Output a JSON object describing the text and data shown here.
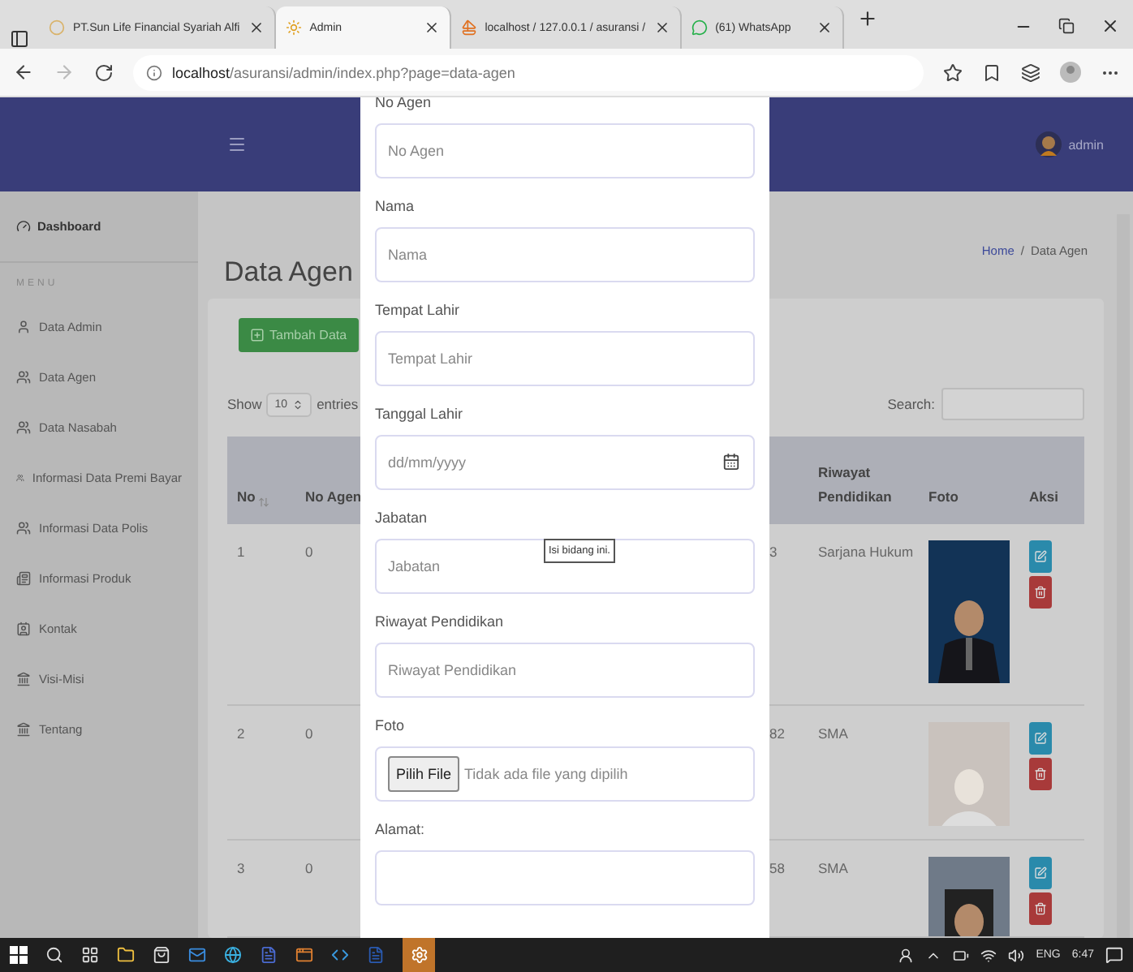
{
  "browser": {
    "tabs": [
      {
        "title": "PT.Sun Life Financial Syariah Alfi",
        "kind": "page",
        "selected": false
      },
      {
        "title": "Admin",
        "kind": "admin",
        "selected": true
      },
      {
        "title": "localhost / 127.0.0.1 / asuransi /",
        "kind": "db",
        "selected": false
      },
      {
        "title": "(61) WhatsApp",
        "kind": "chat",
        "selected": false
      }
    ],
    "url": "**localhost**/asuransi/admin/index.php?page=data-agen"
  },
  "header": {
    "user": "admin"
  },
  "sidebar": {
    "dashboard": "Dashboard",
    "section": "MENU",
    "items": [
      {
        "label": "Data Admin",
        "kind": "user"
      },
      {
        "label": "Data Agen",
        "kind": "group"
      },
      {
        "label": "Data Nasabah",
        "kind": "group"
      },
      {
        "label": "Informasi Data Premi Bayar",
        "kind": "group"
      },
      {
        "label": "Informasi Data Polis",
        "kind": "group"
      },
      {
        "label": "Informasi Produk",
        "kind": "news"
      },
      {
        "label": "Kontak",
        "kind": "contact"
      },
      {
        "label": "Visi-Misi",
        "kind": "building"
      },
      {
        "label": "Tentang",
        "kind": "building"
      }
    ]
  },
  "page": {
    "title": "Data Agen",
    "breadcrumb": {
      "home": "Home",
      "separator": "/",
      "current": "Data Agen"
    },
    "add_button": "Tambah Data",
    "show": {
      "prefix": "Show",
      "value": "10",
      "suffix": "entries"
    },
    "search_label": "Search:",
    "columns": {
      "no": "No",
      "no_agen": "No Agen",
      "riwayat": "Riwayat Pendidikan",
      "foto": "Foto",
      "aksi": "Aksi"
    },
    "rows": [
      {
        "no": "1",
        "no_agen": "0",
        "column_3": "3",
        "riwayat": "Sarjana Hukum"
      },
      {
        "no": "2",
        "no_agen": "0",
        "column_3": "82",
        "riwayat": "SMA"
      },
      {
        "no": "3",
        "no_agen": "0",
        "column_3": "58",
        "riwayat": "SMA"
      }
    ]
  },
  "modal": {
    "fields": [
      {
        "label": "No Agen",
        "kind": "text",
        "placeholder": "No Agen"
      },
      {
        "label": "Nama",
        "kind": "text",
        "placeholder": "Nama"
      },
      {
        "label": "Tempat Lahir",
        "kind": "text",
        "placeholder": "Tempat Lahir"
      },
      {
        "label": "Tanggal Lahir",
        "kind": "date",
        "placeholder": "dd/mm/yyyy"
      },
      {
        "label": "Jabatan",
        "kind": "text",
        "placeholder": "Jabatan"
      },
      {
        "label": "Riwayat Pendidikan",
        "kind": "text",
        "placeholder": "Riwayat Pendidikan"
      },
      {
        "label": "Foto",
        "kind": "file",
        "button": "Pilih File",
        "status": "Tidak ada file yang dipilih"
      },
      {
        "label": "Alamat:",
        "kind": "textarea"
      }
    ],
    "tooltip": "Isi bidang ini."
  },
  "taskbar": {
    "language": "ENG",
    "time": "6:47"
  }
}
